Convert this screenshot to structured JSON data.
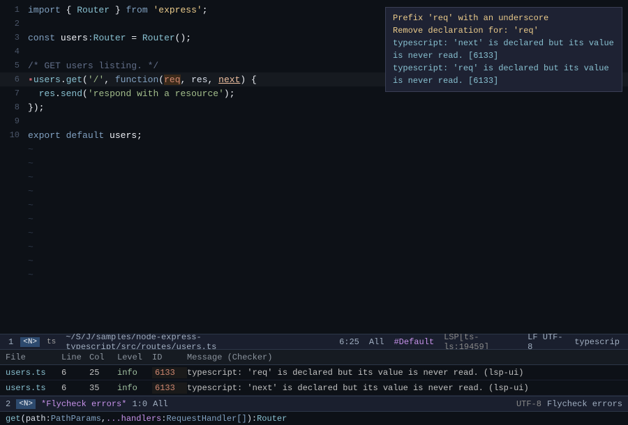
{
  "editor": {
    "lines": [
      {
        "num": 1,
        "content": "import_line"
      },
      {
        "num": 2,
        "content": "blank"
      },
      {
        "num": 3,
        "content": "const_line"
      },
      {
        "num": 4,
        "content": "blank"
      },
      {
        "num": 5,
        "content": "comment_line"
      },
      {
        "num": 6,
        "content": "users_get_line",
        "active": true
      },
      {
        "num": 7,
        "content": "res_send_line"
      },
      {
        "num": 8,
        "content": "close_brace"
      },
      {
        "num": 9,
        "content": "blank"
      },
      {
        "num": 10,
        "content": "export_line"
      }
    ],
    "tildes": [
      11,
      12,
      13,
      14,
      15,
      16,
      17,
      18,
      19,
      20
    ]
  },
  "diag_panel": {
    "action1": "Prefix 'req' with an underscore",
    "action2": "Remove declaration for: 'req'",
    "info1": "typescript: 'next' is declared but its value is never read. [6133]",
    "info2": "typescript: 'req' is declared but its value is never read. [6133]"
  },
  "status_bar": {
    "line_num": "1",
    "mode": "N",
    "ts_icon": "ts",
    "path": "~/S/J/samples/node-express-typescript/src/routes/users.ts",
    "position": "6:25",
    "scope": "All",
    "default_tag": "#Default",
    "lsp": "LSP[ts-ls:19459]",
    "encoding": "LF UTF-8",
    "major_mode": "typescrip"
  },
  "diag_list": {
    "headers": [
      "File",
      "Line",
      "Col",
      "Level",
      "ID",
      "Message (Checker)"
    ],
    "rows": [
      {
        "file": "users.ts",
        "line": "6",
        "col": "25",
        "level": "info",
        "id": "6133",
        "msg": "typescript: 'req' is declared but its value is never read. (lsp-ui)"
      },
      {
        "file": "users.ts",
        "line": "6",
        "col": "35",
        "level": "info",
        "id": "6133",
        "msg": "typescript: 'next' is declared but its value is never read. (lsp-ui)"
      }
    ]
  },
  "bottom_bar": {
    "line_num": "2",
    "mode": "N",
    "flycheck": "*Flycheck errors*",
    "position": "1:0",
    "scope": "All",
    "encoding": "UTF-8",
    "mode_label": "Flycheck errors"
  },
  "mini_buf": {
    "fn": "get",
    "param1": "path",
    "type1": "PathParams",
    "param2": "...handlers",
    "type2": "RequestHandler[]",
    "ret": "Router"
  }
}
